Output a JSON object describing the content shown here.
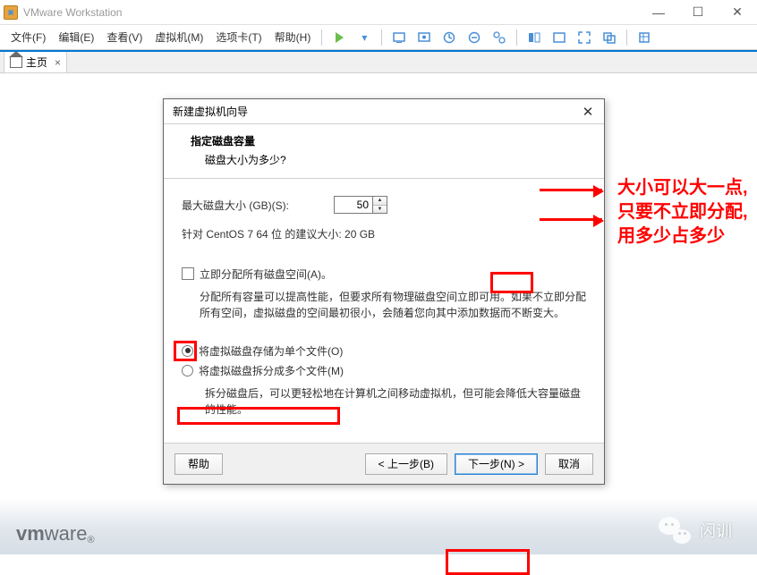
{
  "titlebar": {
    "app_name": "VMware Workstation"
  },
  "menu": {
    "items": [
      "文件(F)",
      "编辑(E)",
      "查看(V)",
      "虚拟机(M)",
      "选项卡(T)",
      "帮助(H)"
    ]
  },
  "tabs": {
    "home_label": "主页"
  },
  "dialog": {
    "title": "新建虚拟机向导",
    "heading": "指定磁盘容量",
    "subheading": "磁盘大小为多少?",
    "disk_label": "最大磁盘大小 (GB)(S):",
    "disk_value": "50",
    "recommended": "针对 CentOS 7 64 位 的建议大小: 20 GB",
    "allocate_now_label": "立即分配所有磁盘空间(A)。",
    "allocate_now_checked": false,
    "allocate_desc": "分配所有容量可以提高性能，但要求所有物理磁盘空间立即可用。如果不立即分配所有空间，虚拟磁盘的空间最初很小，会随着您向其中添加数据而不断变大。",
    "radio_single": "将虚拟磁盘存储为单个文件(O)",
    "radio_split": "将虚拟磁盘拆分成多个文件(M)",
    "radio_selected": "single",
    "split_desc": "拆分磁盘后，可以更轻松地在计算机之间移动虚拟机，但可能会降低大容量磁盘的性能。",
    "buttons": {
      "help": "帮助",
      "back": "< 上一步(B)",
      "next": "下一步(N) >",
      "cancel": "取消"
    }
  },
  "annotations": {
    "line1": "大小可以大一点,",
    "line2": "只要不立即分配,",
    "line3": "用多少占多少"
  },
  "brand": {
    "prefix": "vm",
    "suffix": "ware"
  },
  "watermark": {
    "text": "闪训"
  }
}
